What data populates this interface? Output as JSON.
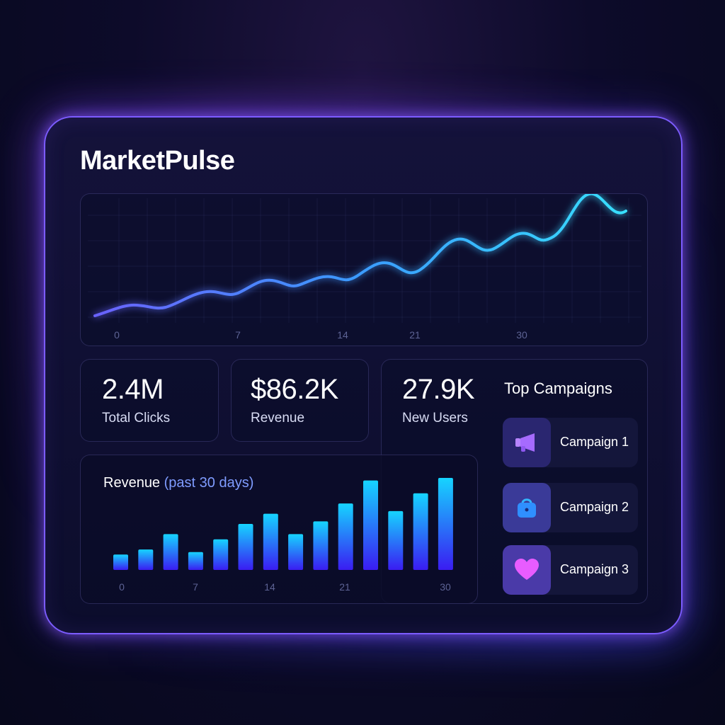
{
  "app": {
    "title": "MarketPulse"
  },
  "colors": {
    "accent": "#7c5cff",
    "line": "#3fc8ff",
    "bar_top": "#14d2ff",
    "bar_bottom": "#3a1cf2",
    "icon_purple": "#a66bff",
    "icon_pink": "#e85cff"
  },
  "line_chart": {
    "chart_data": {
      "type": "line",
      "x_ticks": [
        "0",
        "7",
        "14",
        "21",
        "30"
      ]
    }
  },
  "stats": [
    {
      "value": "2.4M",
      "label": "Total Clicks"
    },
    {
      "value": "$86.2K",
      "label": "Revenue"
    },
    {
      "value": "27.9K",
      "label": "New Users"
    }
  ],
  "revenue_chart": {
    "title": "Revenue",
    "subtitle": "(past 30 days)",
    "chart_data": {
      "type": "bar",
      "x_ticks": [
        "0",
        "7",
        "14",
        "21",
        "30"
      ],
      "values": [
        3,
        4,
        7,
        3.5,
        6,
        9,
        11,
        7,
        9.5,
        13,
        17.5,
        11.5,
        15,
        18
      ]
    }
  },
  "campaigns": {
    "title": "Top Campaigns",
    "items": [
      {
        "label": "Campaign 1",
        "icon": "megaphone-icon"
      },
      {
        "label": "Campaign 2",
        "icon": "shopping-bag-icon"
      },
      {
        "label": "Campaign 3",
        "icon": "heart-icon"
      }
    ]
  }
}
